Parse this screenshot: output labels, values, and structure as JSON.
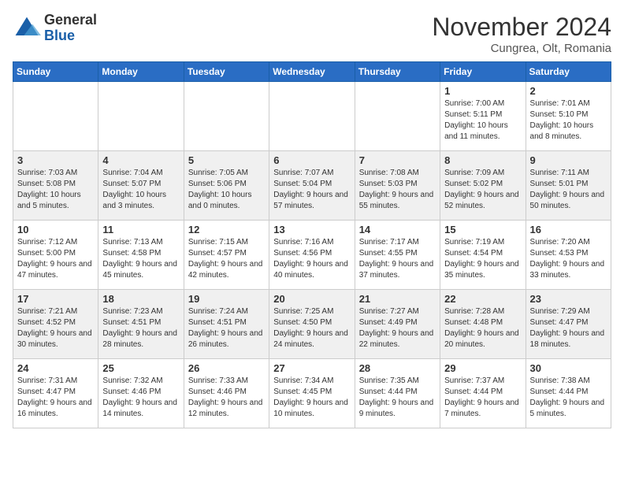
{
  "header": {
    "logo_general": "General",
    "logo_blue": "Blue",
    "month_title": "November 2024",
    "subtitle": "Cungrea, Olt, Romania"
  },
  "weekdays": [
    "Sunday",
    "Monday",
    "Tuesday",
    "Wednesday",
    "Thursday",
    "Friday",
    "Saturday"
  ],
  "weeks": [
    [
      {
        "day": "",
        "info": ""
      },
      {
        "day": "",
        "info": ""
      },
      {
        "day": "",
        "info": ""
      },
      {
        "day": "",
        "info": ""
      },
      {
        "day": "",
        "info": ""
      },
      {
        "day": "1",
        "info": "Sunrise: 7:00 AM\nSunset: 5:11 PM\nDaylight: 10 hours and 11 minutes."
      },
      {
        "day": "2",
        "info": "Sunrise: 7:01 AM\nSunset: 5:10 PM\nDaylight: 10 hours and 8 minutes."
      }
    ],
    [
      {
        "day": "3",
        "info": "Sunrise: 7:03 AM\nSunset: 5:08 PM\nDaylight: 10 hours and 5 minutes."
      },
      {
        "day": "4",
        "info": "Sunrise: 7:04 AM\nSunset: 5:07 PM\nDaylight: 10 hours and 3 minutes."
      },
      {
        "day": "5",
        "info": "Sunrise: 7:05 AM\nSunset: 5:06 PM\nDaylight: 10 hours and 0 minutes."
      },
      {
        "day": "6",
        "info": "Sunrise: 7:07 AM\nSunset: 5:04 PM\nDaylight: 9 hours and 57 minutes."
      },
      {
        "day": "7",
        "info": "Sunrise: 7:08 AM\nSunset: 5:03 PM\nDaylight: 9 hours and 55 minutes."
      },
      {
        "day": "8",
        "info": "Sunrise: 7:09 AM\nSunset: 5:02 PM\nDaylight: 9 hours and 52 minutes."
      },
      {
        "day": "9",
        "info": "Sunrise: 7:11 AM\nSunset: 5:01 PM\nDaylight: 9 hours and 50 minutes."
      }
    ],
    [
      {
        "day": "10",
        "info": "Sunrise: 7:12 AM\nSunset: 5:00 PM\nDaylight: 9 hours and 47 minutes."
      },
      {
        "day": "11",
        "info": "Sunrise: 7:13 AM\nSunset: 4:58 PM\nDaylight: 9 hours and 45 minutes."
      },
      {
        "day": "12",
        "info": "Sunrise: 7:15 AM\nSunset: 4:57 PM\nDaylight: 9 hours and 42 minutes."
      },
      {
        "day": "13",
        "info": "Sunrise: 7:16 AM\nSunset: 4:56 PM\nDaylight: 9 hours and 40 minutes."
      },
      {
        "day": "14",
        "info": "Sunrise: 7:17 AM\nSunset: 4:55 PM\nDaylight: 9 hours and 37 minutes."
      },
      {
        "day": "15",
        "info": "Sunrise: 7:19 AM\nSunset: 4:54 PM\nDaylight: 9 hours and 35 minutes."
      },
      {
        "day": "16",
        "info": "Sunrise: 7:20 AM\nSunset: 4:53 PM\nDaylight: 9 hours and 33 minutes."
      }
    ],
    [
      {
        "day": "17",
        "info": "Sunrise: 7:21 AM\nSunset: 4:52 PM\nDaylight: 9 hours and 30 minutes."
      },
      {
        "day": "18",
        "info": "Sunrise: 7:23 AM\nSunset: 4:51 PM\nDaylight: 9 hours and 28 minutes."
      },
      {
        "day": "19",
        "info": "Sunrise: 7:24 AM\nSunset: 4:51 PM\nDaylight: 9 hours and 26 minutes."
      },
      {
        "day": "20",
        "info": "Sunrise: 7:25 AM\nSunset: 4:50 PM\nDaylight: 9 hours and 24 minutes."
      },
      {
        "day": "21",
        "info": "Sunrise: 7:27 AM\nSunset: 4:49 PM\nDaylight: 9 hours and 22 minutes."
      },
      {
        "day": "22",
        "info": "Sunrise: 7:28 AM\nSunset: 4:48 PM\nDaylight: 9 hours and 20 minutes."
      },
      {
        "day": "23",
        "info": "Sunrise: 7:29 AM\nSunset: 4:47 PM\nDaylight: 9 hours and 18 minutes."
      }
    ],
    [
      {
        "day": "24",
        "info": "Sunrise: 7:31 AM\nSunset: 4:47 PM\nDaylight: 9 hours and 16 minutes."
      },
      {
        "day": "25",
        "info": "Sunrise: 7:32 AM\nSunset: 4:46 PM\nDaylight: 9 hours and 14 minutes."
      },
      {
        "day": "26",
        "info": "Sunrise: 7:33 AM\nSunset: 4:46 PM\nDaylight: 9 hours and 12 minutes."
      },
      {
        "day": "27",
        "info": "Sunrise: 7:34 AM\nSunset: 4:45 PM\nDaylight: 9 hours and 10 minutes."
      },
      {
        "day": "28",
        "info": "Sunrise: 7:35 AM\nSunset: 4:44 PM\nDaylight: 9 hours and 9 minutes."
      },
      {
        "day": "29",
        "info": "Sunrise: 7:37 AM\nSunset: 4:44 PM\nDaylight: 9 hours and 7 minutes."
      },
      {
        "day": "30",
        "info": "Sunrise: 7:38 AM\nSunset: 4:44 PM\nDaylight: 9 hours and 5 minutes."
      }
    ]
  ]
}
